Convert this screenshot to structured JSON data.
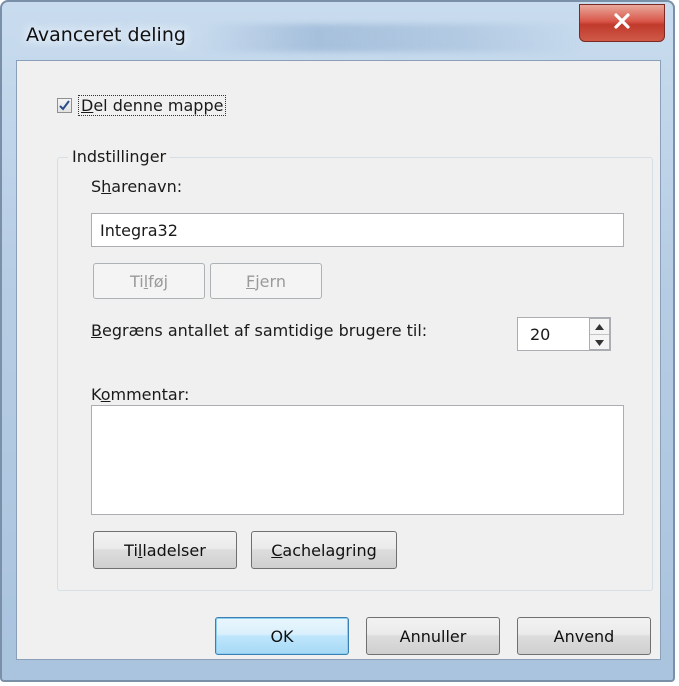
{
  "window": {
    "title": "Avanceret deling",
    "close_icon": "close-icon"
  },
  "share_checkbox": {
    "label_pre": "",
    "label_ul": "D",
    "label_post": "el denne mappe",
    "checked": true
  },
  "settings_group": {
    "title": "Indstillinger",
    "share_name_label_pre": "S",
    "share_name_label_ul": "h",
    "share_name_label_post": "arenavn:",
    "share_name_value": "Integra32",
    "add_button_pre": "Ti",
    "add_button_ul": "l",
    "add_button_post": "føj",
    "remove_button_pre": "",
    "remove_button_ul": "F",
    "remove_button_post": "jern",
    "limit_label_pre": "",
    "limit_label_ul": "B",
    "limit_label_post": "egræns antallet af samtidige brugere til:",
    "limit_value": "20",
    "comment_label_pre": "K",
    "comment_label_ul": "o",
    "comment_label_post": "mmentar:",
    "comment_value": "",
    "permissions_button_pre": "Ti",
    "permissions_button_ul": "l",
    "permissions_button_post": "ladelser",
    "caching_button_pre": "",
    "caching_button_ul": "C",
    "caching_button_post": "achelagring"
  },
  "footer": {
    "ok_label": "OK",
    "cancel_label": "Annuller",
    "apply_label": "Anvend"
  },
  "colors": {
    "accent": "#3c7fb1",
    "close_red": "#c03a2b",
    "dialog_bg": "#f0f0f0"
  }
}
